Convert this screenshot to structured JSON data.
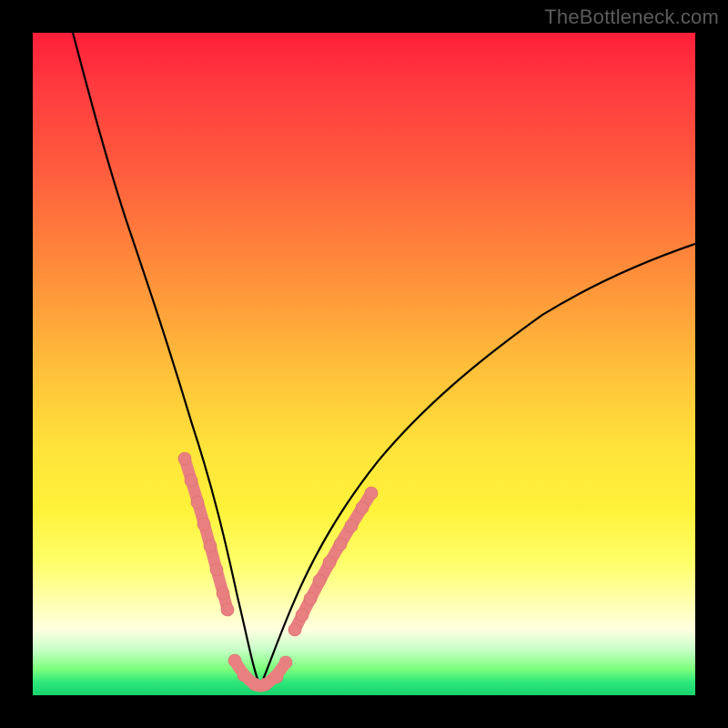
{
  "watermark": "TheBottleneck.com",
  "colors": {
    "bead": "#e98080",
    "curve": "#000000",
    "frame": "#000000"
  },
  "chart_data": {
    "type": "line",
    "title": "",
    "xlabel": "",
    "ylabel": "",
    "xlim": [
      0,
      100
    ],
    "ylim": [
      0,
      100
    ],
    "grid": false,
    "legend": false,
    "note": "V-shaped bottleneck curve on red→green vertical heat gradient. Y is percentage-like (top=100, bottom=0). X is an unlabeled parameter. Curve nadir near x≈34, y≈0. Pink bead markers cluster near the trough. Values estimated from pixel positions; axes are unlabeled in the source image.",
    "series": [
      {
        "name": "curve",
        "x": [
          6,
          10,
          14,
          18,
          21,
          24,
          26,
          28,
          30,
          32,
          34,
          36,
          38,
          41,
          45,
          50,
          56,
          63,
          71,
          80,
          90,
          100
        ],
        "y": [
          100,
          87,
          72,
          57,
          45,
          34,
          25,
          17,
          10,
          5,
          1,
          2,
          5,
          10,
          17,
          25,
          33,
          41,
          49,
          56,
          62,
          68
        ]
      }
    ],
    "markers": {
      "left_segment": {
        "x": [
          22.5,
          23.3,
          24.1,
          25.0,
          25.8,
          26.6,
          27.5
        ],
        "y": [
          35,
          31,
          27,
          23,
          19,
          16,
          13
        ]
      },
      "right_segment": {
        "x": [
          39.0,
          40.0,
          41.0,
          42.2,
          43.6,
          45.0,
          46.5,
          48.0,
          49.8
        ],
        "y": [
          9,
          11,
          13,
          15,
          18,
          20,
          23,
          26,
          29
        ]
      },
      "trough": {
        "x": [
          29.5,
          31.0,
          32.5,
          34.0,
          35.5,
          37.0
        ],
        "y": [
          4.5,
          2.3,
          1.0,
          1.0,
          2.0,
          4.0
        ]
      }
    }
  }
}
